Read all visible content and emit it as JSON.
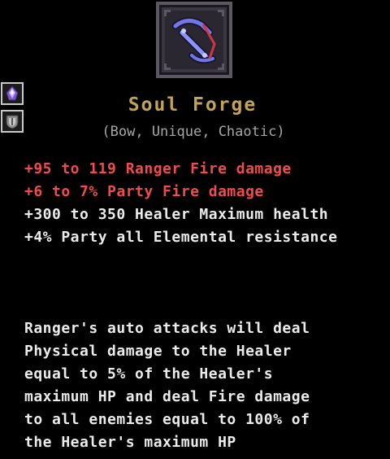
{
  "item": {
    "name": "Soul Forge",
    "tags": "(Bow, Unique, Chaotic)",
    "icon": "bow-icon",
    "sockets": [
      {
        "icon": "purple-gem-icon"
      },
      {
        "icon": "shield-crest-icon"
      }
    ]
  },
  "stats": [
    {
      "text": "+95 to 119 Ranger Fire damage",
      "color": "#f14b4b"
    },
    {
      "text": "+6 to 7% Party Fire damage",
      "color": "#f14b4b"
    },
    {
      "text": "+300 to 350 Healer Maximum health",
      "color": "#ebebeb"
    },
    {
      "text": "+4% Party all Elemental resistance",
      "color": "#ebebeb"
    }
  ],
  "description": {
    "lines": [
      "Ranger's auto attacks will deal",
      "Physical damage to the Healer",
      "equal to 5% of the Healer's",
      "maximum HP and deal Fire damage",
      "to all enemies equal to 100% of",
      "the Healer's maximum HP"
    ]
  },
  "colors": {
    "title": "#c3a356",
    "tags": "#a6a6a6",
    "stat_red": "#f14b4b",
    "stat_white": "#ebebeb",
    "background": "#000000"
  }
}
